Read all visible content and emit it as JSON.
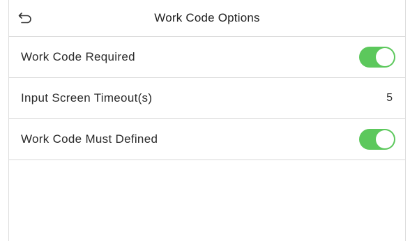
{
  "header": {
    "title": "Work Code Options",
    "back_icon": "back-arrow-icon"
  },
  "settings": [
    {
      "label": "Work Code Required",
      "type": "toggle",
      "enabled": true
    },
    {
      "label": "Input Screen Timeout(s)",
      "type": "value",
      "value": "5"
    },
    {
      "label": "Work Code Must Defined",
      "type": "toggle",
      "enabled": true
    }
  ],
  "colors": {
    "toggle_on": "#5cc85c",
    "divider": "#d9d9d9",
    "text": "#2a2a2a"
  }
}
